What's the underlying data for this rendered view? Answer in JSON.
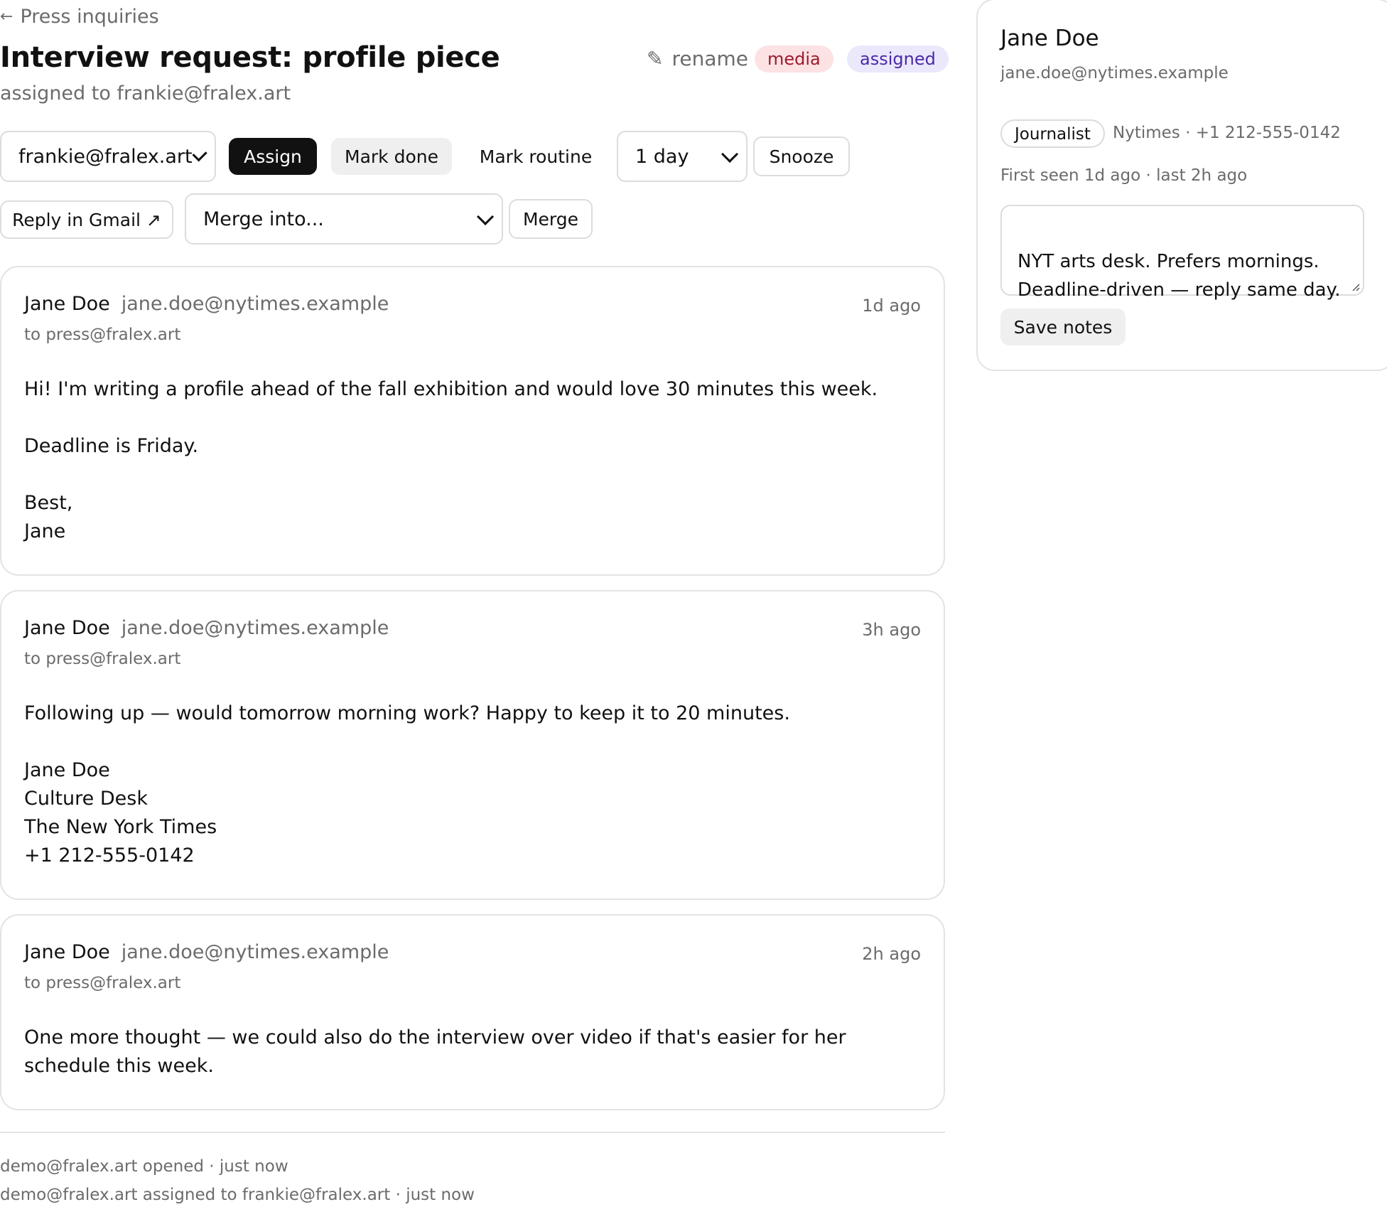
{
  "header": {
    "back_label": "Press inquiries",
    "title": "Interview request: profile piece",
    "assigned_to": "assigned to frankie@fralex.art",
    "rename_label": "rename",
    "tags": [
      "media",
      "assigned"
    ]
  },
  "toolbar": {
    "assignee_select": "frankie@fralex.art",
    "assign_label": "Assign",
    "mark_done_label": "Mark done",
    "mark_routine_label": "Mark routine",
    "snooze_select": "1 day",
    "snooze_label": "Snooze",
    "reply_label": "Reply in Gmail ↗",
    "merge_select": "Merge into...",
    "merge_label": "Merge"
  },
  "messages": [
    {
      "sender_name": "Jane Doe",
      "sender_email": "jane.doe@nytimes.example",
      "time": "1d ago",
      "to": "to press@fralex.art",
      "paragraphs": [
        "Hi! I'm writing a profile ahead of the fall exhibition and would love 30 minutes this week.",
        "Deadline is Friday.",
        "Best,\nJane"
      ]
    },
    {
      "sender_name": "Jane Doe",
      "sender_email": "jane.doe@nytimes.example",
      "time": "3h ago",
      "to": "to press@fralex.art",
      "paragraphs": [
        "Following up — would tomorrow morning work? Happy to keep it to 20 minutes.",
        "Jane Doe\nCulture Desk\nThe New York Times\n+1 212-555-0142"
      ]
    },
    {
      "sender_name": "Jane Doe",
      "sender_email": "jane.doe@nytimes.example",
      "time": "2h ago",
      "to": "to press@fralex.art",
      "paragraphs": [
        "One more thought — we could also do the interview over video if that's easier for her schedule this week."
      ]
    }
  ],
  "activity": [
    "demo@fralex.art opened · just now",
    "demo@fralex.art assigned to frankie@fralex.art · just now"
  ],
  "contact": {
    "name": "Jane Doe",
    "email": "jane.doe@nytimes.example",
    "role": "Journalist",
    "meta": "Nytimes · +1 212-555-0142",
    "seen": "First seen 1d ago · last 2h ago",
    "notes": "NYT arts desk. Prefers mornings.\nDeadline-driven — reply same day.",
    "save_label": "Save notes"
  }
}
